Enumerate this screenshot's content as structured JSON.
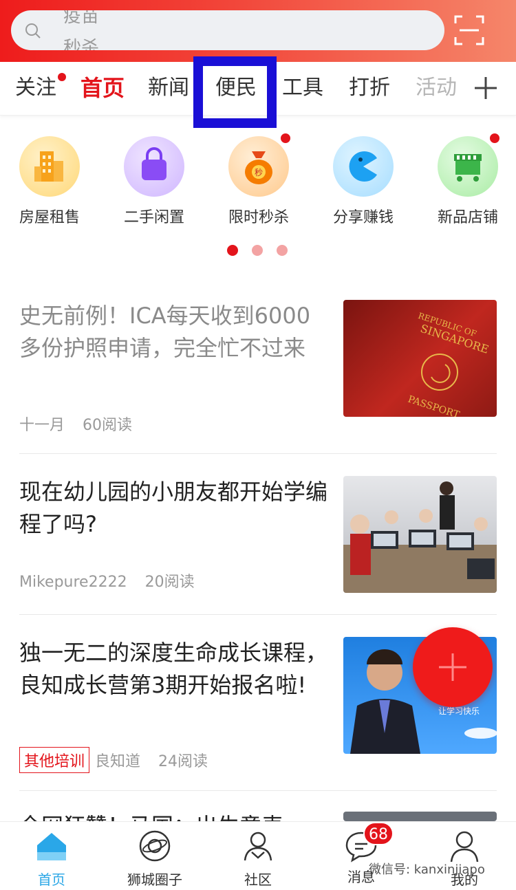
{
  "search": {
    "rolling_text": [
      "疫苗",
      "秒杀"
    ]
  },
  "tabs": [
    {
      "label": "关注",
      "dot": true
    },
    {
      "label": "首页",
      "active": true
    },
    {
      "label": "新闻"
    },
    {
      "label": "便民",
      "highlighted": true
    },
    {
      "label": "工具"
    },
    {
      "label": "打折"
    },
    {
      "label": "活动"
    }
  ],
  "quick": [
    {
      "label": "房屋租售",
      "icon": "building-icon",
      "colors": [
        "#fff1c9",
        "#ffd878"
      ]
    },
    {
      "label": "二手闲置",
      "icon": "bag-icon",
      "colors": [
        "#efe4ff",
        "#cfb6ff"
      ]
    },
    {
      "label": "限时秒杀",
      "icon": "money-bag-icon",
      "colors": [
        "#ffeed6",
        "#ffc98c"
      ],
      "dot": true,
      "icon_text": "秒"
    },
    {
      "label": "分享赚钱",
      "icon": "pacman-icon",
      "colors": [
        "#dff4ff",
        "#a6ddff"
      ]
    },
    {
      "label": "新品店铺",
      "icon": "shop-stall-icon",
      "colors": [
        "#e4fbe2",
        "#a9eca4"
      ],
      "dot": true
    }
  ],
  "articles": [
    {
      "title": "史无前例！ICA每天收到6000多份护照申请，完全忙不过来",
      "read": true,
      "meta": [
        "十一月",
        "60阅读"
      ],
      "thumb": "passport-image",
      "thumb_text": [
        "REPUBLIC OF",
        "SINGAPORE",
        "PASSPORT"
      ]
    },
    {
      "title": "现在幼儿园的小朋友都开始学编程了吗?",
      "read": false,
      "meta": [
        "Mikepure2222",
        "20阅读"
      ],
      "thumb": "classroom-image"
    },
    {
      "title": "独一无二的深度生命成长课程，良知成长营第3期开始报名啦!",
      "read": false,
      "tag": "其他培训",
      "meta": [
        "良知道",
        "24阅读"
      ],
      "thumb": "speaker-image",
      "thumb_text": [
        "让学习快乐"
      ]
    }
  ],
  "partial_article_title": "全网狂赞！马国：出生意表",
  "bottom_nav": [
    {
      "label": "首页",
      "icon": "home-icon",
      "active": true
    },
    {
      "label": "狮城圈子",
      "icon": "planet-icon"
    },
    {
      "label": "社区",
      "icon": "community-icon"
    },
    {
      "label": "消息",
      "icon": "chat-icon",
      "badge": "68"
    },
    {
      "label": "我的",
      "icon": "user-icon"
    }
  ],
  "watermark": "微信号: kanxinjiapo",
  "colors": {
    "brand_red": "#e3141b",
    "active_blue": "#29a6e6",
    "highlight": "#1a0fd6"
  }
}
